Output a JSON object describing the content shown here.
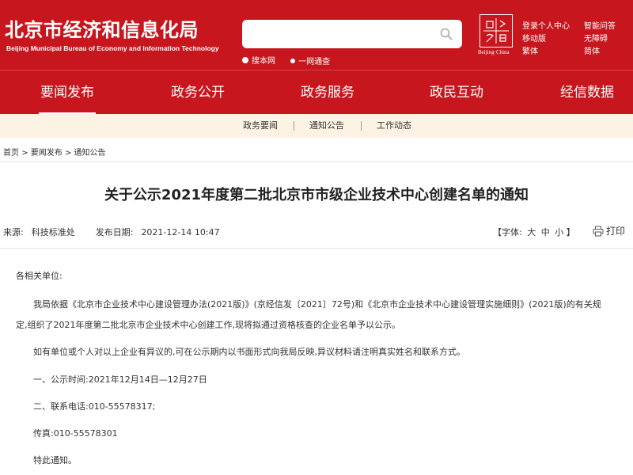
{
  "header": {
    "title": "北京市经济和信息化局",
    "subtitle": "Beijing Municipal Bureau of Economy and Information Technology",
    "search": {
      "placeholder": "",
      "options": [
        "搜本网",
        "一网通查"
      ]
    },
    "logo_caption": "Beijing·China",
    "top_links": [
      "登录个人中心",
      "智能问答",
      "移动版",
      "无障碍",
      "繁体",
      "简体"
    ]
  },
  "nav": {
    "items": [
      "要闻发布",
      "政务公开",
      "政务服务",
      "政民互动",
      "经信数据"
    ]
  },
  "subnav": {
    "items": [
      "政务要闻",
      "通知公告",
      "工作动态"
    ]
  },
  "breadcrumb": [
    "首页",
    "要闻发布",
    "通知公告"
  ],
  "article": {
    "title": "关于公示2021年度第二批北京市市级企业技术中心创建名单的通知",
    "source_label": "来源:",
    "source": "科技标准处",
    "date_label": "发布日期:",
    "date": "2021-12-14 10:47",
    "font_label": "【字体:",
    "font_options": [
      "大",
      "中",
      "小"
    ],
    "font_close": "】",
    "print_label": "打印",
    "paragraphs": [
      "各相关单位:",
      "我局依据《北京市企业技术中心建设管理办法(2021版)》(京经信发〔2021〕72号)和《北京市企业技术中心建设管理实施细则》(2021版)的有关规",
      "定,组织了2021年度第二批北京市企业技术中心创建工作,现将拟通过资格核查的企业名单予以公示。",
      "如有单位或个人对以上企业有异议的,可在公示期内以书面形式向我局反映,异议材料请注明真实姓名和联系方式。",
      "一、公示时间:2021年12月14日—12月27日",
      "二、联系电话:010-55578317;",
      "传真:010-55578301",
      "特此通知。"
    ]
  },
  "colors": {
    "brand_red": "#c8161e",
    "subnav_bg": "#fdf3e4"
  }
}
